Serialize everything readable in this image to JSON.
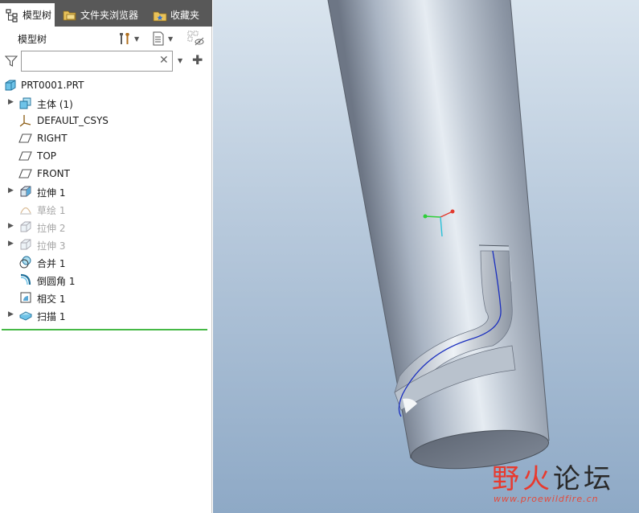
{
  "tabs": {
    "model_tree": "模型树",
    "folder_browser": "文件夹浏览器",
    "favorites": "收藏夹"
  },
  "tree_header": {
    "title": "模型树"
  },
  "search": {
    "value": "",
    "placeholder": ""
  },
  "tree": {
    "root": {
      "label": "PRT0001.PRT",
      "icon": "part-icon"
    },
    "items": [
      {
        "label": "主体 (1)",
        "icon": "body-icon",
        "expandable": true,
        "suppressed": false
      },
      {
        "label": "DEFAULT_CSYS",
        "icon": "csys-icon",
        "expandable": false,
        "suppressed": false
      },
      {
        "label": "RIGHT",
        "icon": "datum-plane-icon",
        "expandable": false,
        "suppressed": false
      },
      {
        "label": "TOP",
        "icon": "datum-plane-icon",
        "expandable": false,
        "suppressed": false
      },
      {
        "label": "FRONT",
        "icon": "datum-plane-icon",
        "expandable": false,
        "suppressed": false
      },
      {
        "label": "拉伸 1",
        "icon": "extrude-icon",
        "expandable": true,
        "suppressed": false
      },
      {
        "label": "草绘 1",
        "icon": "sketch-icon",
        "expandable": false,
        "suppressed": true
      },
      {
        "label": "拉伸 2",
        "icon": "extrude-icon",
        "expandable": true,
        "suppressed": true
      },
      {
        "label": "拉伸 3",
        "icon": "extrude-icon",
        "expandable": true,
        "suppressed": true
      },
      {
        "label": "合并 1",
        "icon": "merge-icon",
        "expandable": false,
        "suppressed": false
      },
      {
        "label": "倒圆角 1",
        "icon": "round-icon",
        "expandable": false,
        "suppressed": false
      },
      {
        "label": "相交 1",
        "icon": "intersect-icon",
        "expandable": false,
        "suppressed": false
      },
      {
        "label": "扫描 1",
        "icon": "sweep-icon",
        "expandable": true,
        "suppressed": false
      }
    ]
  },
  "watermark": {
    "part1": "野火",
    "part2": "论坛",
    "url": "www.proewildfire.cn"
  },
  "colors": {
    "tab_bar": "#585858",
    "insert_line": "#46b946",
    "suppressed_text": "#a6a6a6",
    "watermark_red": "#e83a2e"
  }
}
